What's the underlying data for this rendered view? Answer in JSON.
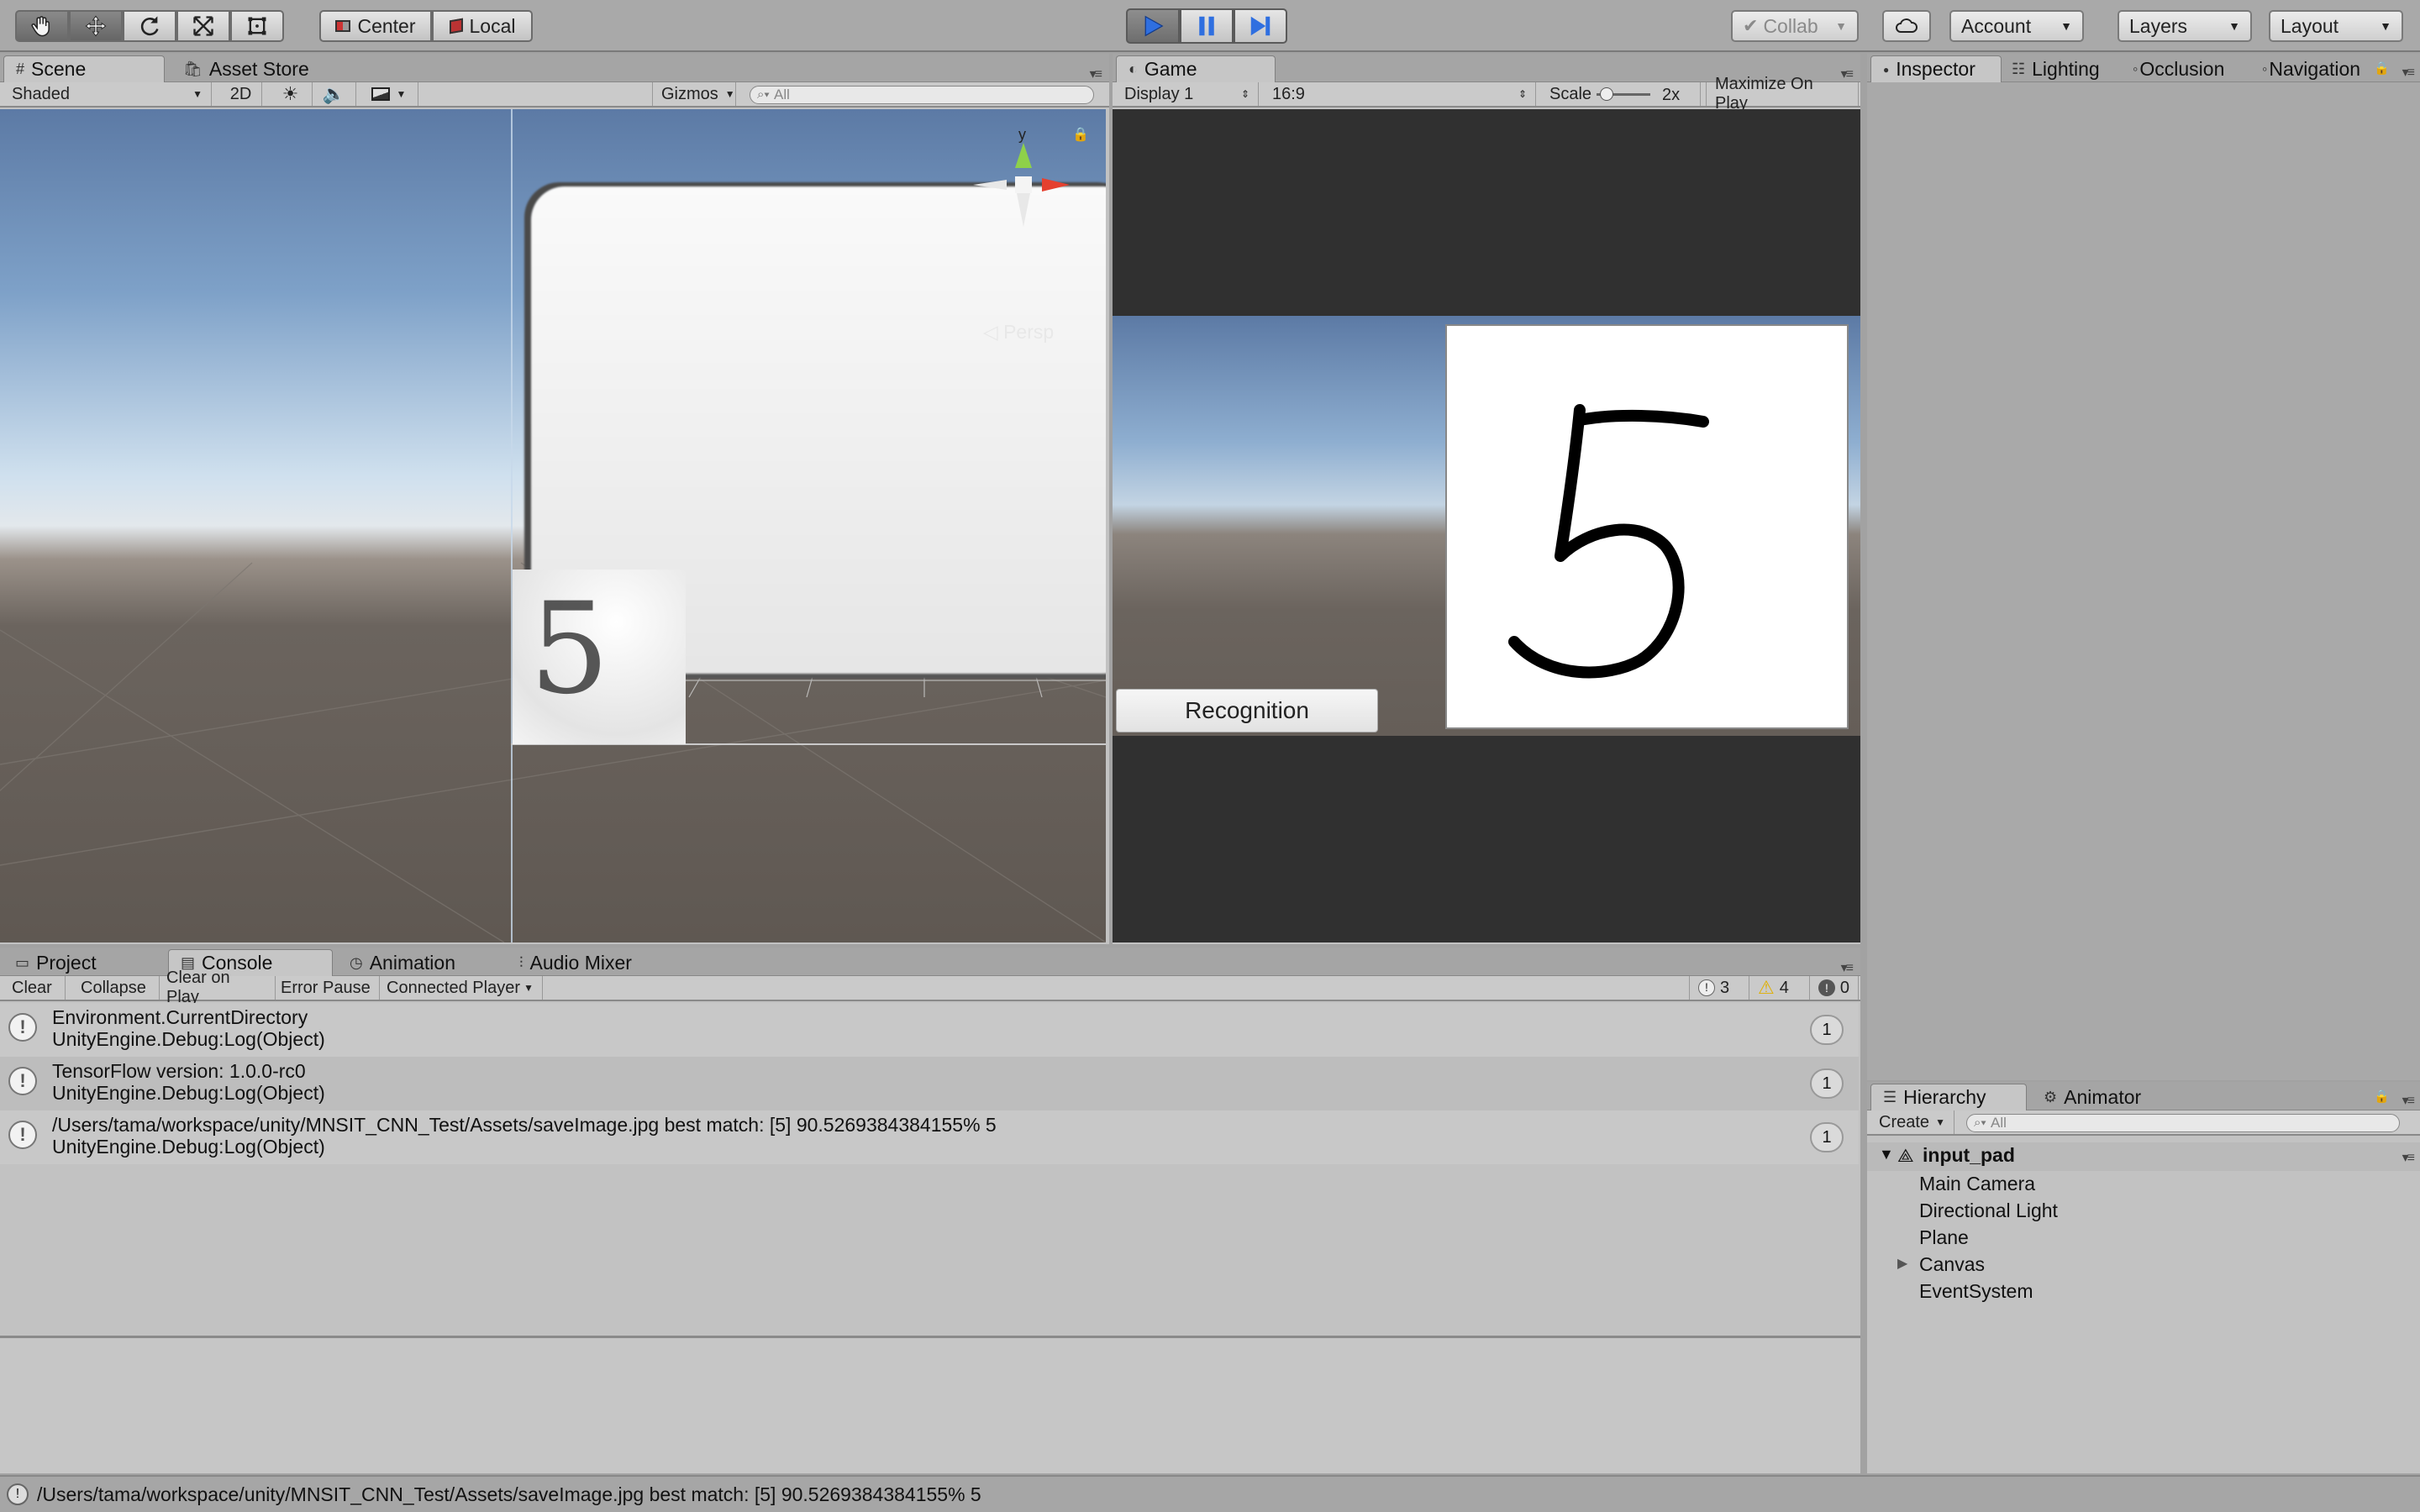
{
  "toolbar": {
    "pivot_center": "Center",
    "pivot_local": "Local",
    "collab": "Collab",
    "account": "Account",
    "layers": "Layers",
    "layout": "Layout"
  },
  "scene": {
    "tabs": [
      "Scene",
      "Asset Store"
    ],
    "shading": "Shaded",
    "mode_2d": "2D",
    "gizmos": "Gizmos",
    "search_placeholder": "All",
    "persp": "Persp",
    "axis_y": "y"
  },
  "game": {
    "tab": "Game",
    "display": "Display 1",
    "aspect": "16:9",
    "scale_label": "Scale",
    "scale_value": "2x",
    "maximize": "Maximize On Play",
    "recognition_button": "Recognition",
    "drawn_digit": "5"
  },
  "inspector": {
    "tabs": [
      "Inspector",
      "Lighting",
      "Occlusion",
      "Navigation"
    ]
  },
  "bottom": {
    "tabs": [
      "Project",
      "Console",
      "Animation",
      "Audio Mixer"
    ]
  },
  "console": {
    "buttons": [
      "Clear",
      "Collapse",
      "Clear on Play",
      "Error Pause",
      "Connected Player"
    ],
    "counts": {
      "info": "3",
      "warn": "4",
      "error": "0"
    },
    "entries": [
      {
        "line1": "Environment.CurrentDirectory",
        "line2": "UnityEngine.Debug:Log(Object)",
        "count": "1"
      },
      {
        "line1": "TensorFlow version: 1.0.0-rc0",
        "line2": "UnityEngine.Debug:Log(Object)",
        "count": "1"
      },
      {
        "line1": "/Users/tama/workspace/unity/MNSIT_CNN_Test/Assets/saveImage.jpg best match: [5] 90.5269384384155% 5",
        "line2": "UnityEngine.Debug:Log(Object)",
        "count": "1"
      }
    ]
  },
  "hierarchy": {
    "tabs": [
      "Hierarchy",
      "Animator"
    ],
    "create": "Create",
    "search_placeholder": "All",
    "scene_name": "input_pad",
    "items": [
      "Main Camera",
      "Directional Light",
      "Plane",
      "Canvas",
      "EventSystem"
    ]
  },
  "status_bar": {
    "message": "/Users/tama/workspace/unity/MNSIT_CNN_Test/Assets/saveImage.jpg best match: [5] 90.5269384384155% 5"
  },
  "colors": {
    "play_blue": "#2f6fe0",
    "sky_top": "#5f7fa8",
    "ground": "#6b645e",
    "game_bg": "#303030"
  }
}
